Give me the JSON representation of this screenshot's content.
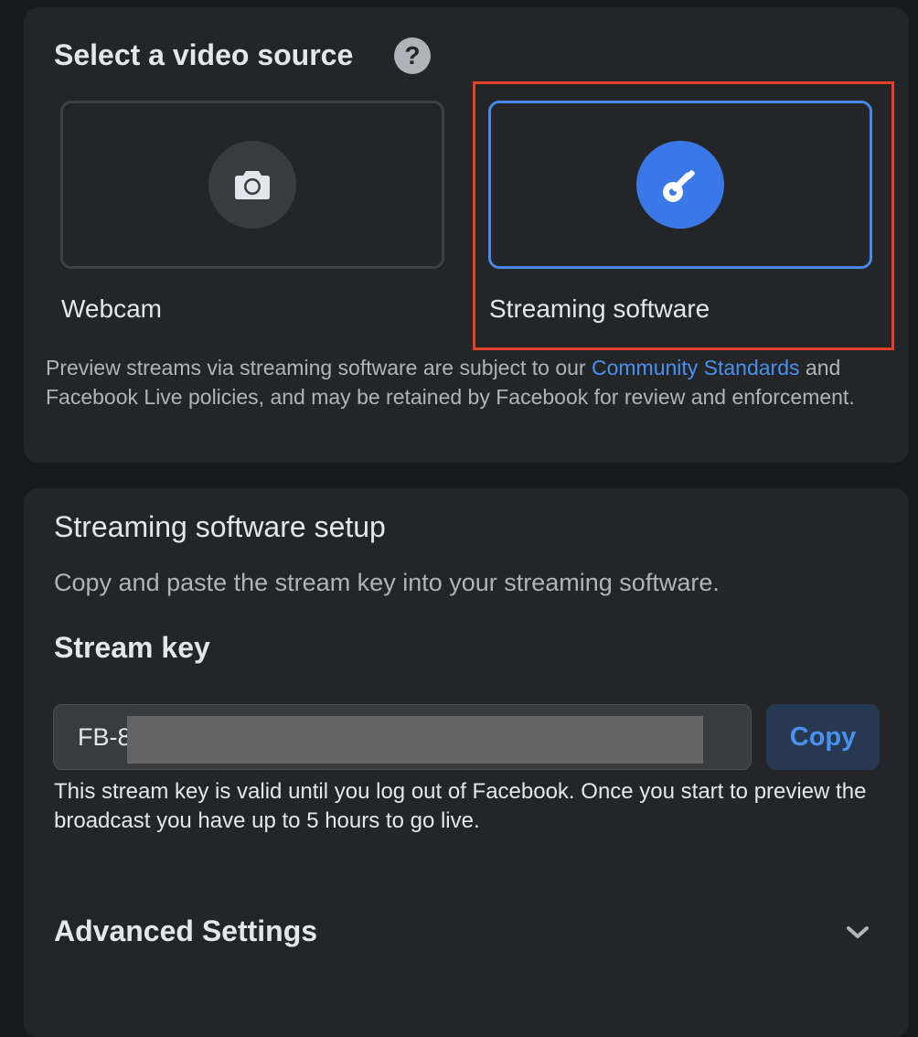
{
  "video_source": {
    "title": "Select a video source",
    "help_icon": "question-circle-icon",
    "help_glyph": "?",
    "options": [
      {
        "label": "Webcam",
        "icon": "camera-icon",
        "selected": false
      },
      {
        "label": "Streaming software",
        "icon": "key-icon",
        "selected": true
      }
    ],
    "policy_text_before": "Preview streams via streaming software are subject to our ",
    "policy_link": "Community Standards",
    "policy_text_after": " and Facebook Live policies, and may be retained by Facebook for review and enforcement."
  },
  "setup": {
    "title": "Streaming software setup",
    "description": "Copy and paste the stream key into your streaming software.",
    "stream_key_title": "Stream key",
    "stream_key_visible": "FB-8",
    "copy_label": "Copy",
    "note": "This stream key is valid until you log out of Facebook. Once you start to preview the broadcast you have up to 5 hours to go live.",
    "advanced_title": "Advanced Settings",
    "advanced_icon": "chevron-down-icon"
  },
  "colors": {
    "accent": "#3b78e7",
    "link": "#4a90f0",
    "highlight_box": "#e5402b",
    "card_bg": "#242526",
    "page_bg": "#18191a"
  }
}
